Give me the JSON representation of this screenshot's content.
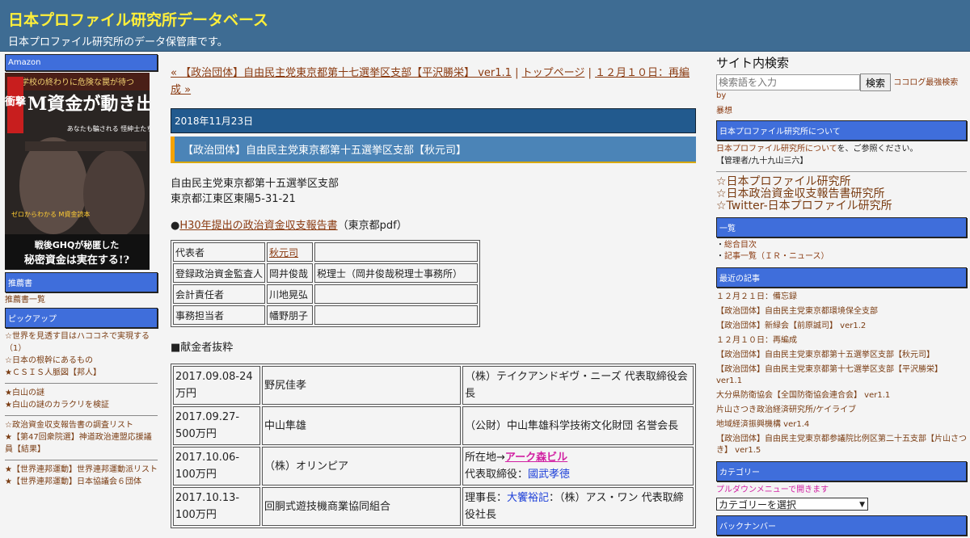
{
  "header": {
    "title": "日本プロファイル研究所データベース",
    "description": "日本プロファイル研究所のデータ保管庫です。"
  },
  "left_sidebar": {
    "amazon_heading": "Amazon",
    "book": {
      "kicker": "学校の終わりに危険な罠が待つ",
      "cover_left": "衝撃",
      "cover_big": "M資金が動き出す",
      "cover_side": "あなたも騙される 怪紳士たちの殺し文句",
      "cover_tag": "ゼロからわかる M資金読本",
      "cover_bottom1": "戦後GHQが秘匿した",
      "cover_bottom2": "秘密資金は実在する!?"
    },
    "recommend_heading": "推薦書",
    "recommend_link": "推薦書一覧",
    "pickup_heading": "ピックアップ",
    "group1": [
      "☆世界を見透す目はハココネで実現する（1）",
      "☆日本の根幹にあるもの",
      "★ＣＳＩＳ人脈図【邦人】"
    ],
    "group2": [
      "★白山の謎",
      "★白山の謎のカラクリを検証"
    ],
    "group3": [
      "☆政治資金収支報告書の調査リスト",
      "★【第47回衆院選】神道政治連盟応援議員【結果】"
    ],
    "group4": [
      "★【世界連邦運動】世界連邦運動派リスト",
      "★【世界連邦運動】日本協議会６団体"
    ]
  },
  "main": {
    "nav_prev": "« 【政治団体】自由民主党東京都第十七選挙区支部【平沢勝栄】 ver1.1",
    "nav_sep1": " | ",
    "nav_top": "トップページ",
    "nav_sep2": " | ",
    "nav_next": "１２月１０日：再編成 »",
    "date": "2018年11月23日",
    "post_title": "【政治団体】自由民主党東京都第十五選挙区支部【秋元司】",
    "org_name": "自由民主党東京都第十五選挙区支部",
    "org_address": "東京都江東区東陽5-31-21",
    "report_bullet": "●",
    "report_link": "H30年提出の政治資金収支報告書",
    "report_note": "（東京都pdf）",
    "officers": [
      {
        "role": "代表者",
        "name": "秋元司",
        "note": ""
      },
      {
        "role": "登録政治資金監査人",
        "name": "岡井俊哉",
        "note": "税理士（岡井俊哉税理士事務所）"
      },
      {
        "role": "会計責任者",
        "name": "川地晃弘",
        "note": ""
      },
      {
        "role": "事務担当者",
        "name": "幡野朋子",
        "note": ""
      }
    ],
    "donor_heading": "■献金者抜粋",
    "donors": [
      {
        "date": "2017.09.08-24万円",
        "name": "野尻佳孝",
        "detail_pre": "（株）テイクアンドギヴ・ニーズ 代表取締役会長",
        "link": "",
        "detail_mid": "",
        "link2": ""
      },
      {
        "date": "2017.09.27-500万円",
        "name": "中山隼雄",
        "detail_pre": "（公財）中山隼雄科学技術文化財団 名誉会長",
        "link": "",
        "detail_mid": "",
        "link2": ""
      },
      {
        "date": "2017.10.06-100万円",
        "name": "（株）オリンピア",
        "detail_pre": "所在地→",
        "link": "アーク森ビル",
        "detail_mid": "代表取締役：",
        "link2": "國武孝徳"
      },
      {
        "date": "2017.10.13-100万円",
        "name": "回胴式遊技機商業協同組合",
        "detail_pre": "理事長：",
        "link": "大饗裕記",
        "detail_mid": "：（株）アス・ワン 代表取締役社長",
        "link2": ""
      }
    ]
  },
  "right_sidebar": {
    "search_title": "サイト内検索",
    "search_placeholder": "検索語を入力",
    "search_button": "検索",
    "search_credit1": "ココログ最強検索 by",
    "search_credit2": "暴想",
    "about_heading": "日本プロファイル研究所について",
    "about_link": "日本プロファイル研究所について",
    "about_rest": "を、ご参照ください。",
    "admin": "【管理者/九十九山三六】",
    "big_links": [
      "☆日本プロファイル研究所",
      "☆日本政治資金収支報告書研究所",
      "☆Twitter-日本プロファイル研究所"
    ],
    "list_heading": "一覧",
    "list_items": [
      "総合目次",
      "記事一覧（ＩＲ・ニュース）"
    ],
    "recent_heading": "最近の記事",
    "recent_items": [
      "１２月２１日：備忘録",
      "【政治団体】自由民主党東京都環境保全支部",
      "【政治団体】新緑会【前原誠司】 ver1.2",
      "１２月１０日：再編成",
      "【政治団体】自由民主党東京都第十五選挙区支部【秋元司】",
      "【政治団体】自由民主党東京都第十七選挙区支部【平沢勝栄】 ver1.1",
      "大分県防衛協会【全国防衛協会連合会】 ver1.1",
      "片山さつき政治経済研究所/ケイライブ",
      "地域経済振興機構 ver1.4",
      "【政治団体】自由民主党東京都参議院比例区第二十五支部【片山さつき】 ver1.5"
    ],
    "category_heading": "カテゴリー",
    "category_note": "プルダウンメニューで開きます",
    "category_select": "カテゴリーを選択",
    "backnumber_heading": "バックナンバー"
  }
}
